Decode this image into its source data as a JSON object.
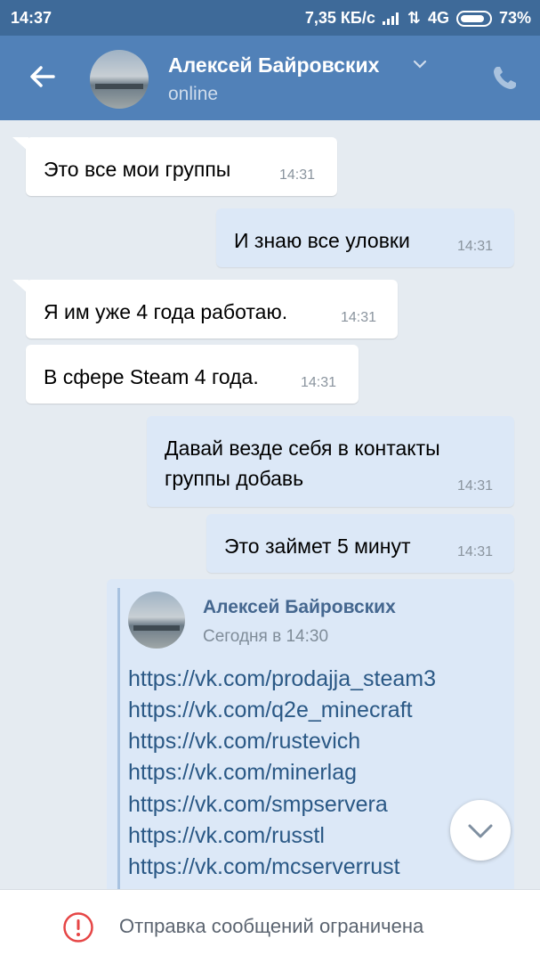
{
  "status_bar": {
    "time": "14:37",
    "speed": "7,35 КБ/с",
    "network": "4G",
    "battery": "73%"
  },
  "header": {
    "contact_name": "Алексей Байровских",
    "status": "online"
  },
  "messages": [
    {
      "direction": "in",
      "text": "Это все мои группы",
      "time": "14:31"
    },
    {
      "direction": "out",
      "text": "И знаю все уловки",
      "time": "14:31"
    },
    {
      "direction": "in",
      "text": "Я им уже 4 года работаю.",
      "time": "14:31"
    },
    {
      "direction": "in",
      "text": "В сфере Steam 4 года.",
      "time": "14:31"
    },
    {
      "direction": "out",
      "lines": [
        "Давай везде себя в контакты",
        "группы добавь"
      ],
      "time": "14:31"
    },
    {
      "direction": "out",
      "text": "Это займет 5 минут",
      "time": "14:31"
    }
  ],
  "forwarded": {
    "author": "Алексей Байровских",
    "date": "Сегодня в 14:30",
    "links": [
      "https://vk.com/prodajja_steam3",
      "https://vk.com/q2e_minecraft",
      "https://vk.com/rustevich",
      "https://vk.com/minerlag",
      "https://vk.com/smpservera",
      "https://vk.com/russtl",
      "https://vk.com/mcserverrust"
    ]
  },
  "bottom_bar": {
    "notice": "Отправка сообщений ограничена"
  },
  "colors": {
    "header": "#5181b8",
    "status_bar": "#3e6a99",
    "background": "#e5ebf1",
    "outgoing_bubble": "#dce8f7",
    "link": "#2a5885",
    "warning": "#e64646"
  },
  "icons": [
    "back-arrow-icon",
    "chevron-down-icon",
    "phone-icon",
    "scroll-down-icon",
    "warning-icon",
    "signal-icon",
    "battery-icon"
  ]
}
